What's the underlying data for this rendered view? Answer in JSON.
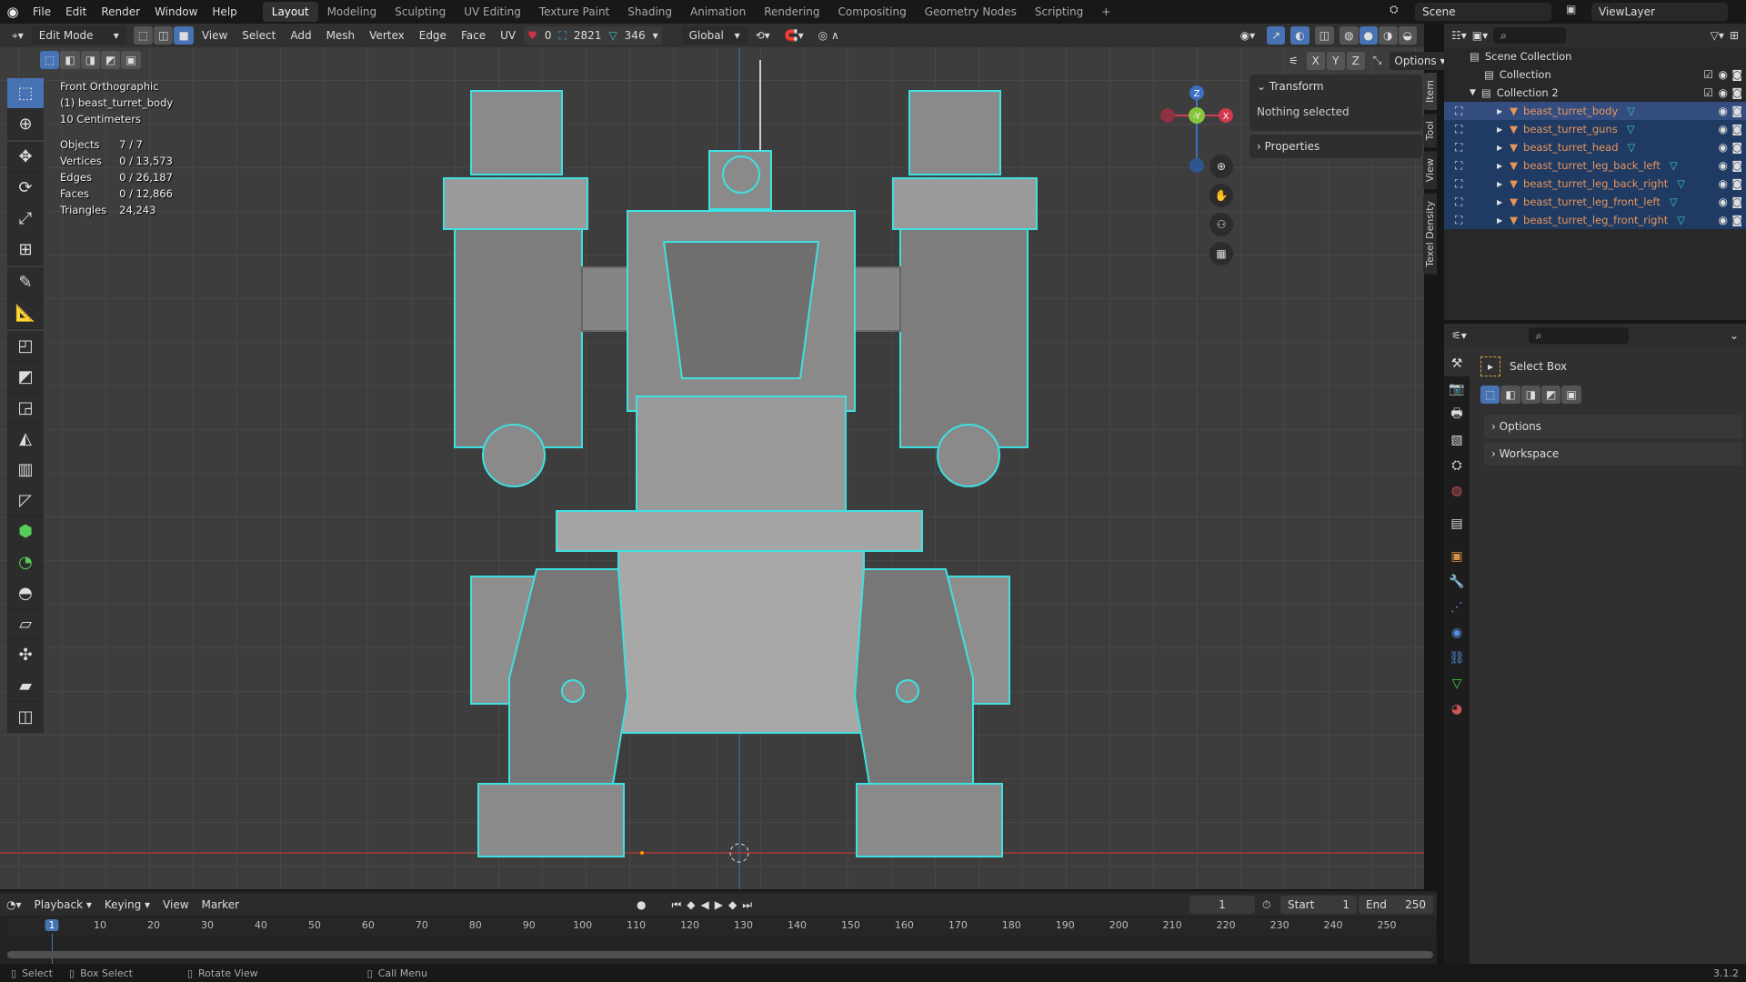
{
  "menu": {
    "items": [
      "File",
      "Edit",
      "Render",
      "Window",
      "Help"
    ],
    "workspaces": [
      "Layout",
      "Modeling",
      "Sculpting",
      "UV Editing",
      "Texture Paint",
      "Shading",
      "Animation",
      "Rendering",
      "Compositing",
      "Geometry Nodes",
      "Scripting"
    ],
    "add": "+",
    "scene": "Scene",
    "view_layer": "ViewLayer"
  },
  "viewport_header": {
    "mode": "Edit Mode",
    "menus": [
      "View",
      "Select",
      "Add",
      "Mesh",
      "Vertex",
      "Edge",
      "Face",
      "UV"
    ],
    "stat_red": "0",
    "stat_blue": "2821",
    "stat_teal": "346",
    "orientation": "Global",
    "axes": [
      "X",
      "Y",
      "Z"
    ],
    "options": "Options"
  },
  "overlay": {
    "view": "Front Orthographic",
    "object": "(1) beast_turret_body",
    "scale": "10 Centimeters",
    "stats": [
      {
        "label": "Objects",
        "value": "7 / 7"
      },
      {
        "label": "Vertices",
        "value": "0 / 13,573"
      },
      {
        "label": "Edges",
        "value": "0 / 26,187"
      },
      {
        "label": "Faces",
        "value": "0 / 12,866"
      },
      {
        "label": "Triangles",
        "value": "24,243"
      }
    ]
  },
  "gizmo": {
    "z": "Z",
    "y": "-Y",
    "x": "X"
  },
  "npanel": {
    "transform": "Transform",
    "nothing": "Nothing selected",
    "properties": "Properties",
    "tabs": [
      "Item",
      "Tool",
      "View",
      "Texel Density"
    ]
  },
  "outliner": {
    "scene_collection": "Scene Collection",
    "collections": [
      "Collection",
      "Collection 2"
    ],
    "objects": [
      "beast_turret_body",
      "beast_turret_guns",
      "beast_turret_head",
      "beast_turret_leg_back_left",
      "beast_turret_leg_back_right",
      "beast_turret_leg_front_left",
      "beast_turret_leg_front_right"
    ]
  },
  "properties": {
    "tool": "Select Box",
    "sections": [
      "Options",
      "Workspace"
    ]
  },
  "timeline": {
    "menus": [
      "Playback",
      "Keying",
      "View",
      "Marker"
    ],
    "current_frame": "1",
    "start_label": "Start",
    "start": "1",
    "end_label": "End",
    "end": "250",
    "ticks": [
      1,
      10,
      20,
      30,
      40,
      50,
      60,
      70,
      80,
      90,
      100,
      110,
      120,
      130,
      140,
      150,
      160,
      170,
      180,
      190,
      200,
      210,
      220,
      230,
      240,
      250
    ]
  },
  "status": {
    "items": [
      "Select",
      "Box Select",
      "Rotate View",
      "Call Menu"
    ],
    "version": "3.1.2"
  },
  "colors": {
    "accent": "#4772b3",
    "wire": "#3fe0e0",
    "object_name": "#e8955a"
  }
}
